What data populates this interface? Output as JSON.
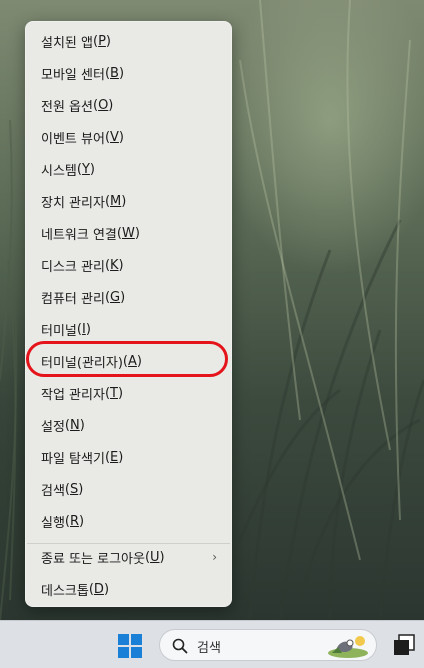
{
  "context_menu": {
    "items": [
      {
        "label": "설치된 앱",
        "key": "P"
      },
      {
        "label": "모바일 센터",
        "key": "B"
      },
      {
        "label": "전원 옵션",
        "key": "O"
      },
      {
        "label": "이벤트 뷰어",
        "key": "V"
      },
      {
        "label": "시스템",
        "key": "Y"
      },
      {
        "label": "장치 관리자",
        "key": "M"
      },
      {
        "label": "네트워크 연결",
        "key": "W"
      },
      {
        "label": "디스크 관리",
        "key": "K"
      },
      {
        "label": "컴퓨터 관리",
        "key": "G"
      },
      {
        "label": "터미널",
        "key": "I"
      },
      {
        "label": "터미널(관리자)",
        "key": "A"
      },
      {
        "label": "작업 관리자",
        "key": "T"
      },
      {
        "label": "설정",
        "key": "N"
      },
      {
        "label": "파일 탐색기",
        "key": "E"
      },
      {
        "label": "검색",
        "key": "S"
      },
      {
        "label": "실행",
        "key": "R"
      },
      {
        "label": "종료 또는 로그아웃",
        "key": "U"
      },
      {
        "label": "데스크톱",
        "key": "D"
      }
    ],
    "submenu_arrow": "›",
    "highlighted_item": "터미널(관리자)"
  },
  "taskbar": {
    "search_placeholder": "검색",
    "icons": [
      "windows-start-icon",
      "search-icon",
      "search-highlight-icon",
      "terminal-app-icon"
    ]
  },
  "colors": {
    "highlight_ring": "#e4141a",
    "start_blue": "#1a7fd6",
    "menu_bg": "#e9eae6"
  }
}
